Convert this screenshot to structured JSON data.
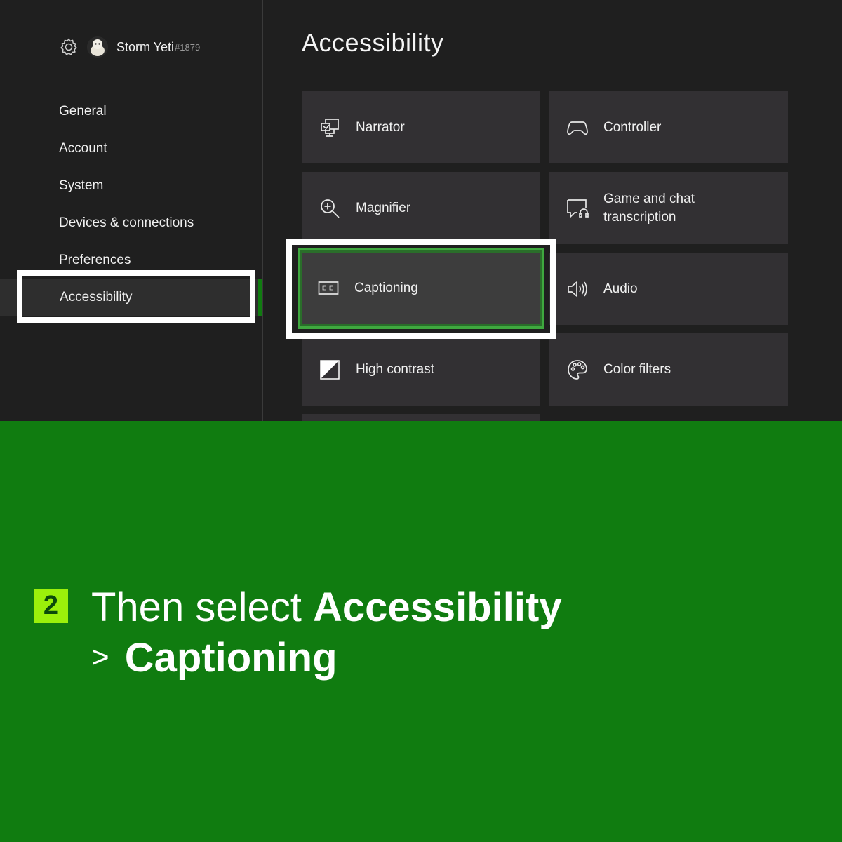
{
  "profile": {
    "gamertag": "Storm Yeti",
    "suffix": "#1879"
  },
  "sidebar": {
    "items": [
      {
        "label": "General"
      },
      {
        "label": "Account"
      },
      {
        "label": "System"
      },
      {
        "label": "Devices & connections"
      },
      {
        "label": "Preferences"
      },
      {
        "label": "Accessibility",
        "selected": true
      }
    ]
  },
  "main": {
    "title": "Accessibility",
    "tiles": [
      {
        "label": "Narrator",
        "icon": "narrator-icon"
      },
      {
        "label": "Controller",
        "icon": "controller-icon"
      },
      {
        "label": "Magnifier",
        "icon": "magnifier-icon"
      },
      {
        "label": "Game and chat transcription",
        "line1": "Game and chat",
        "line2": "transcription",
        "icon": "chat-transcription-icon"
      },
      {
        "label": "Captioning",
        "icon": "cc-icon",
        "focused": true
      },
      {
        "label": "Audio",
        "icon": "speaker-icon"
      },
      {
        "label": "High contrast",
        "icon": "high-contrast-icon"
      },
      {
        "label": "Color filters",
        "icon": "palette-icon"
      }
    ]
  },
  "instruction": {
    "step": "2",
    "line1_prefix": "Then select ",
    "line1_bold": "Accessibility",
    "line2_chevron": ">",
    "line2_bold": "Captioning"
  },
  "colors": {
    "brand_green": "#107c10",
    "step_badge": "#9bf00b",
    "background": "#1f1f1f",
    "tile": "#323033"
  }
}
